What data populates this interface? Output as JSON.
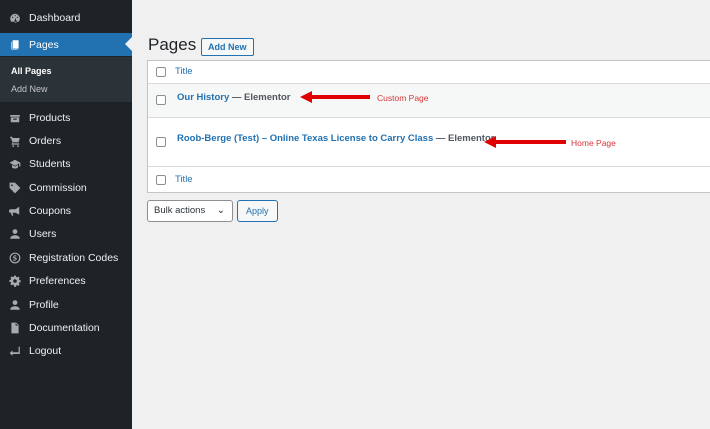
{
  "sidebar": {
    "items": [
      {
        "label": "Dashboard",
        "icon": "dashboard-icon"
      },
      {
        "label": "Pages",
        "icon": "pages-icon",
        "active": true
      },
      {
        "label": "Products",
        "icon": "products-icon"
      },
      {
        "label": "Orders",
        "icon": "cart-icon"
      },
      {
        "label": "Students",
        "icon": "graduation-cap-icon"
      },
      {
        "label": "Commission",
        "icon": "tag-icon"
      },
      {
        "label": "Coupons",
        "icon": "megaphone-icon"
      },
      {
        "label": "Users",
        "icon": "user-icon"
      },
      {
        "label": "Registration Codes",
        "icon": "dollar-circle-icon"
      },
      {
        "label": "Preferences",
        "icon": "gear-icon"
      },
      {
        "label": "Profile",
        "icon": "user-icon"
      },
      {
        "label": "Documentation",
        "icon": "document-icon"
      },
      {
        "label": "Logout",
        "icon": "logout-icon"
      }
    ],
    "submenu": [
      "All Pages",
      "Add New"
    ]
  },
  "page": {
    "title": "Pages",
    "add_new": "Add New"
  },
  "table": {
    "header": "Title",
    "footer": "Title",
    "rows": [
      {
        "title": "Our History",
        "state": " — Elementor"
      },
      {
        "title": "Roob-Berge (Test) – Online Texas License to Carry Class",
        "state": " — Elementor"
      }
    ]
  },
  "actions": {
    "bulk_label": "Bulk actions",
    "apply_label": "Apply"
  },
  "annotations": {
    "custom_page": "Custom Page",
    "home_page": "Home Page",
    "color": "#e00000"
  },
  "colors": {
    "sidebar_bg": "#1d2327",
    "accent": "#2271b1",
    "annotation": "#e00000"
  }
}
